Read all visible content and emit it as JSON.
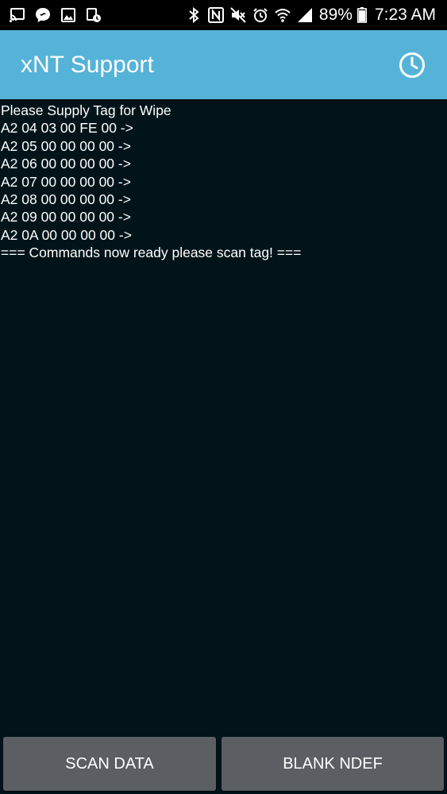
{
  "status_bar": {
    "left_icons": [
      "cast-icon",
      "chat-bubble-icon",
      "image-icon",
      "screen-record-icon"
    ],
    "right_icons": [
      "bluetooth-icon",
      "nfc-icon",
      "mute-icon",
      "alarm-icon",
      "wifi-icon",
      "signal-icon",
      "battery-icon"
    ],
    "battery_percent": "89%",
    "time": "7:23 AM"
  },
  "app_bar": {
    "title": "xNT Support",
    "action_icon": "history-icon",
    "color": "#55b3d8"
  },
  "log": {
    "lines": [
      "Please Supply Tag for Wipe",
      "A2 04 03 00 FE 00 ->",
      "A2 05 00 00 00 00 ->",
      "A2 06 00 00 00 00 ->",
      "A2 07 00 00 00 00 ->",
      "A2 08 00 00 00 00 ->",
      "A2 09 00 00 00 00 ->",
      "A2 0A 00 00 00 00 ->",
      "=== Commands now ready please scan tag! ==="
    ]
  },
  "buttons": {
    "scan_data": "SCAN DATA",
    "blank_ndef": "BLANK NDEF"
  },
  "colors": {
    "background": "#02141a",
    "button": "#5b5e63",
    "text": "#ffffff"
  }
}
